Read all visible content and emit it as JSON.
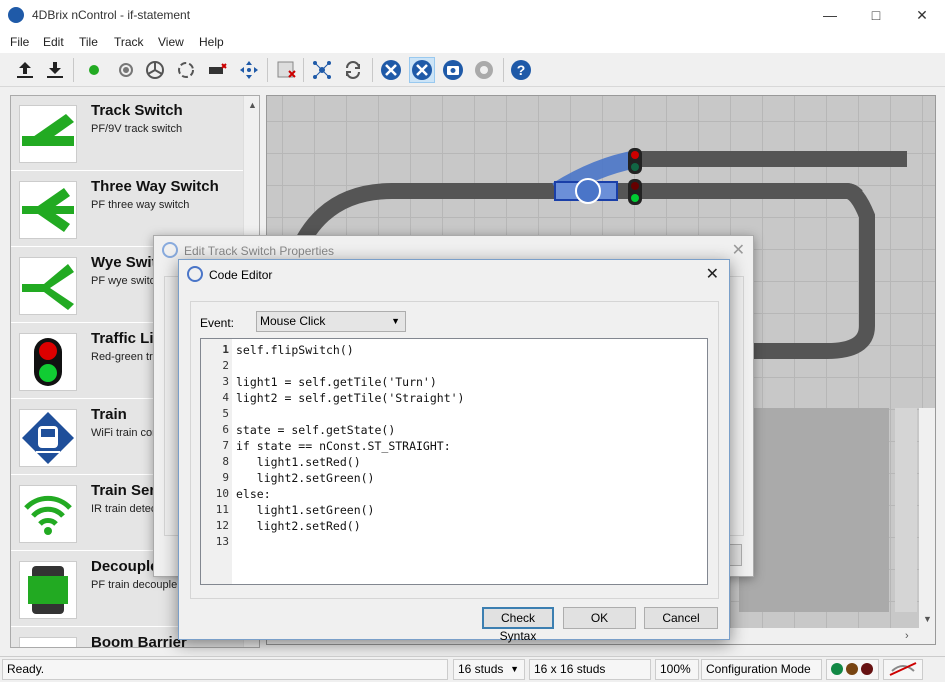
{
  "window": {
    "title": "4DBrix nControl - if-statement"
  },
  "menu": [
    "File",
    "Edit",
    "Tile",
    "Track",
    "View",
    "Help"
  ],
  "toolbar": {
    "icons": [
      "upload-icon",
      "download-icon",
      "connect-icon",
      "signal-icon",
      "wheel-icon",
      "loop-icon",
      "decoupler-icon",
      "crosshair-icon",
      "delete-icon",
      "network-icon",
      "sync-icon",
      "tools-icon",
      "tools-active-icon",
      "camera-icon",
      "gear-icon",
      "help-icon"
    ]
  },
  "palette": {
    "items": [
      {
        "name": "Track Switch",
        "desc": "PF/9V track switch"
      },
      {
        "name": "Three Way Switch",
        "desc": "PF three way switch"
      },
      {
        "name": "Wye Switch",
        "desc": "PF wye switch"
      },
      {
        "name": "Traffic Light",
        "desc": "Red-green traffic light"
      },
      {
        "name": "Train",
        "desc": "WiFi train controller"
      },
      {
        "name": "Train Sensor",
        "desc": "IR train detector"
      },
      {
        "name": "Decoupler",
        "desc": "PF train decoupler"
      },
      {
        "name": "Boom Barrier",
        "desc": ""
      }
    ]
  },
  "edit_dialog": {
    "title": "Edit Track Switch Properties"
  },
  "code_dialog": {
    "title": "Code Editor",
    "event_label": "Event:",
    "event_value": "Mouse Click",
    "lines": [
      "self.flipSwitch()",
      "",
      "light1 = self.getTile('Turn')",
      "light2 = self.getTile('Straight')",
      "",
      "state = self.getState()",
      "if state == nConst.ST_STRAIGHT:",
      "   light1.setRed()",
      "   light2.setGreen()",
      "else:",
      "   light1.setGreen()",
      "   light2.setRed()",
      ""
    ],
    "line_numbers": [
      "1",
      "2",
      "3",
      "4",
      "5",
      "6",
      "7",
      "8",
      "9",
      "10",
      "11",
      "12",
      "13"
    ],
    "check_label": "Check Syntax",
    "ok_label": "OK",
    "cancel_label": "Cancel"
  },
  "status": {
    "text": "Ready.",
    "grid": "16 studs",
    "size": "16 x 16 studs",
    "zoom": "100%",
    "mode": "Configuration Mode"
  },
  "colors": {
    "track_green": "#22aa22",
    "accent": "#1f5aa8",
    "signal_red": "#cc0000"
  }
}
